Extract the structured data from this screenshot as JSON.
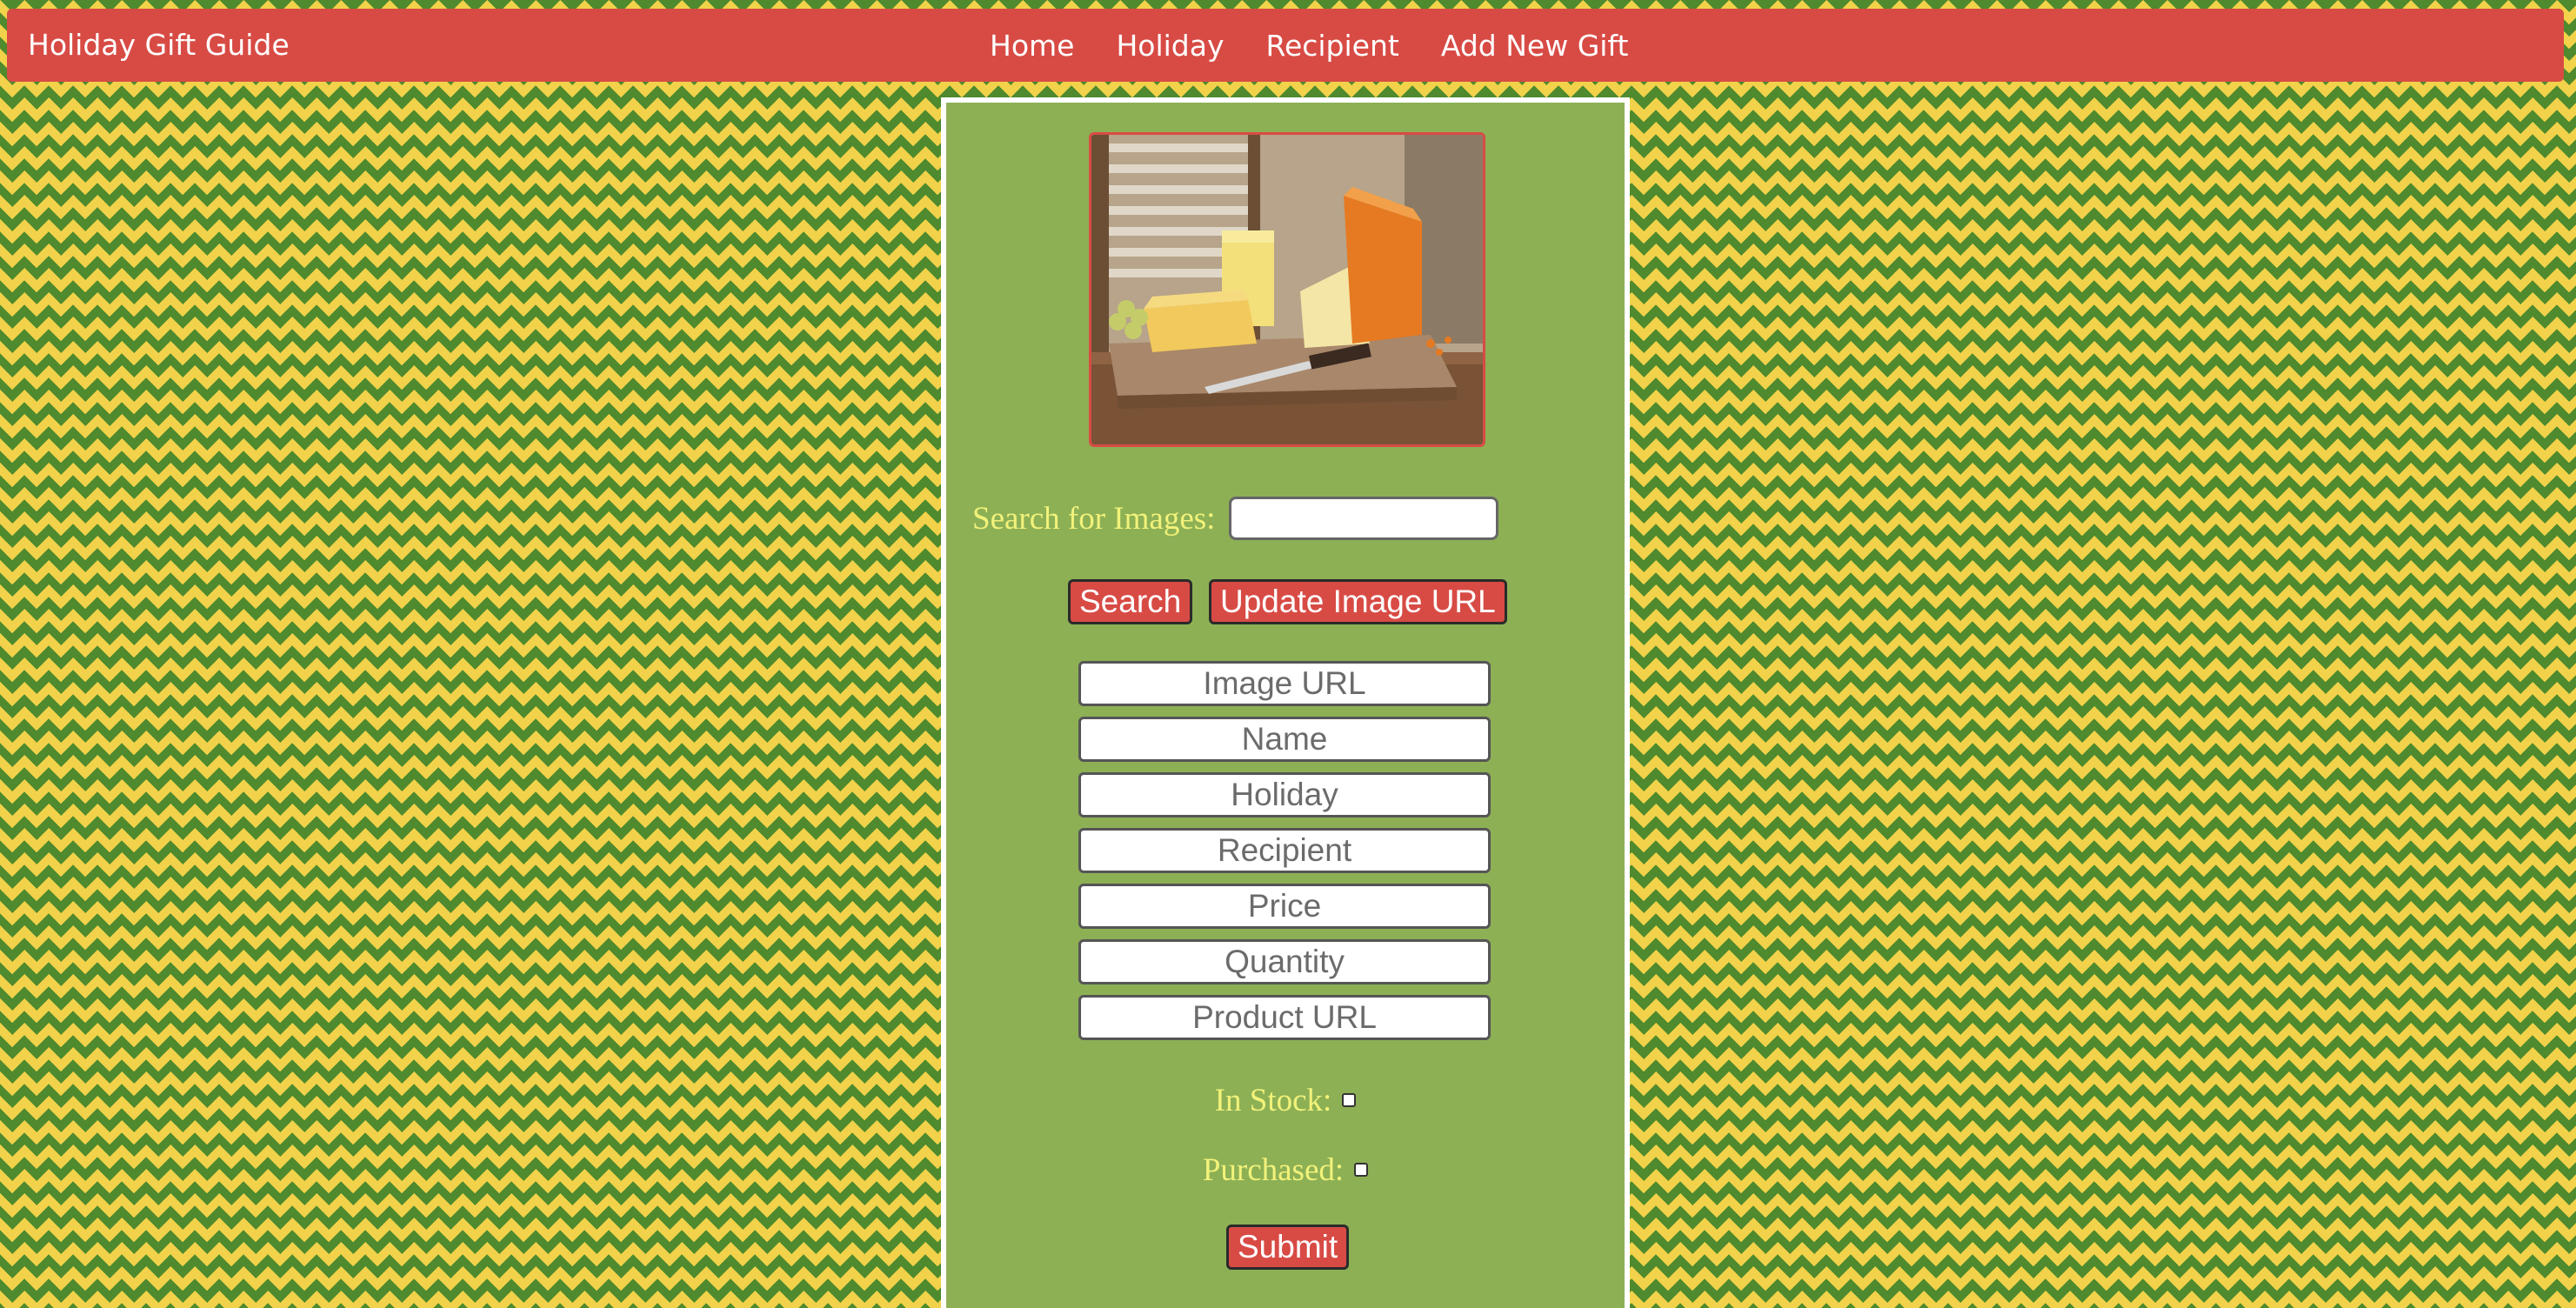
{
  "navbar": {
    "brand": "Holiday Gift Guide",
    "links": [
      "Home",
      "Holiday",
      "Recipient",
      "Add New Gift"
    ]
  },
  "form": {
    "search_label": "Search for Images:",
    "search_value": "",
    "search_button": "Search",
    "update_button": "Update Image URL",
    "fields": {
      "image_url": "Image URL",
      "name": "Name",
      "holiday": "Holiday",
      "recipient": "Recipient",
      "price": "Price",
      "quantity": "Quantity",
      "product_url": "Product URL"
    },
    "in_stock_label": "In Stock:",
    "purchased_label": "Purchased:",
    "submit_button": "Submit"
  },
  "colors": {
    "accent": "#d84b45",
    "panel": "#8db055",
    "label": "#f2f27a",
    "background_yellow": "#f2d24a",
    "background_green": "#4f8a2e"
  },
  "image": {
    "subject": "cheese-board-photo"
  }
}
